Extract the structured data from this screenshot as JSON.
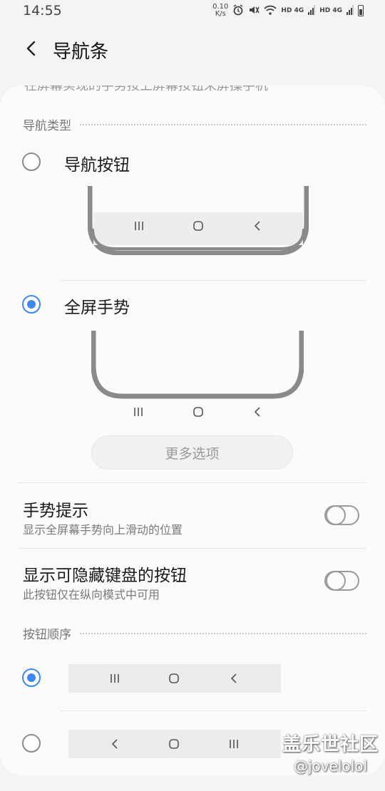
{
  "status_bar": {
    "time": "14:55",
    "net_speed_value": "0.10",
    "net_speed_unit": "K/s",
    "sim1": "HD 4G",
    "sim2": "HD 4G"
  },
  "header": {
    "title": "导航条"
  },
  "card": {
    "cut_text": "在屏幕实现的手势按上屏幕按钮来屏操手机"
  },
  "nav_type": {
    "section_title": "导航类型",
    "options": [
      {
        "label": "导航按钮",
        "selected": false
      },
      {
        "label": "全屏手势",
        "selected": true
      }
    ],
    "more_options_label": "更多选项"
  },
  "settings": [
    {
      "title": "手势提示",
      "subtitle": "显示全屏幕手势向上滑动的位置",
      "enabled": false
    },
    {
      "title": "显示可隐藏键盘的按钮",
      "subtitle": "此按钮仅在纵向模式中可用",
      "enabled": false
    }
  ],
  "button_order": {
    "section_title": "按钮顺序",
    "options": [
      {
        "order": [
          "recents-icon",
          "home-icon",
          "back-icon"
        ],
        "selected": true
      },
      {
        "order": [
          "back-icon",
          "home-icon",
          "recents-icon"
        ],
        "selected": false
      }
    ]
  },
  "watermark": {
    "main": "盖乐世社区",
    "sub": "@jovelolol"
  },
  "colors": {
    "accent": "#3e89f1",
    "background": "#f4f4f4",
    "card": "#fbfbfb"
  }
}
